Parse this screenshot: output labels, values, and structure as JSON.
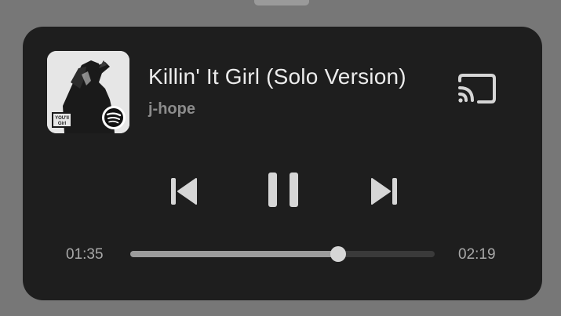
{
  "media_player": {
    "track_title": "Killin' It Girl (Solo Version)",
    "artist": "j-hope",
    "album_art_text": "YOU'll Girl",
    "source_app_icon": "spotify-icon",
    "cast_icon": "cast-icon",
    "controls": {
      "previous_icon": "skip-previous-icon",
      "play_pause_icon": "pause-icon",
      "next_icon": "skip-next-icon"
    },
    "progress": {
      "elapsed": "01:35",
      "total": "02:19",
      "fraction": 0.683
    },
    "colors": {
      "background": "#777777",
      "card": "#1e1e1e",
      "title": "#ececec",
      "artist": "#8c8c8c",
      "icons": "#d6d6d6",
      "progress_fill": "#9c9c9c",
      "progress_track": "#3a3a3a"
    }
  }
}
